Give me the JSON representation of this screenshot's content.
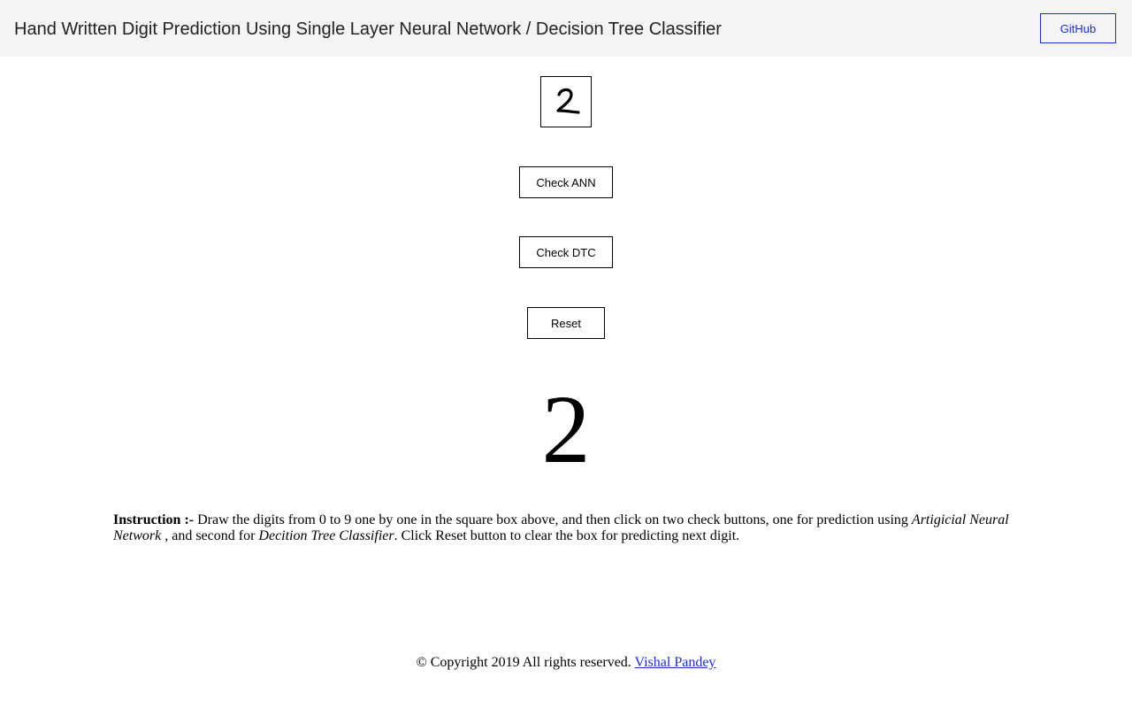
{
  "header": {
    "title": "Hand Written Digit Prediction Using Single Layer Neural Network / Decision Tree Classifier",
    "github_label": "GitHub"
  },
  "canvas": {
    "drawn_digit_icon": "handwritten-digit-2-stroke"
  },
  "buttons": {
    "check_ann": "Check ANN",
    "check_dtc": "Check DTC",
    "reset": "Reset"
  },
  "result": {
    "prediction": "2"
  },
  "instruction": {
    "label": "Instruction :-",
    "text_1": " Draw the digits from 0 to 9 one by one in the square box above, and then click on two check buttons, one for prediction using ",
    "ann_term": "Artigicial Neural Network",
    "text_2": " , and second for ",
    "dtc_term": "Decition Tree Classifier",
    "text_3": ". Click Reset button to clear the box for predicting next digit."
  },
  "footer": {
    "copyright": "© Copyright 2019 All rights reserved. ",
    "author": "Vishal Pandey"
  },
  "colors": {
    "link": "#1a2fd6",
    "topbar_bg": "#f4f4f4"
  }
}
